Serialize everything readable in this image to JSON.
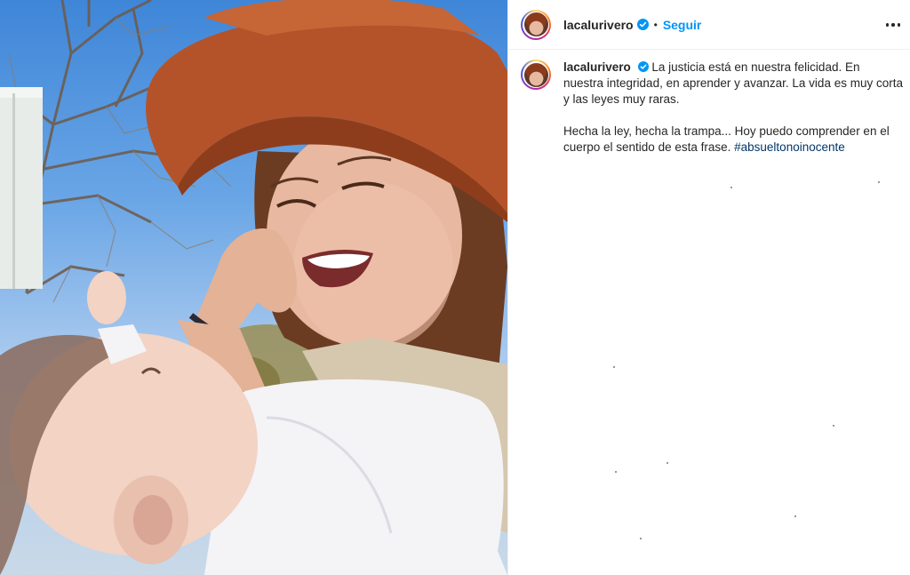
{
  "post": {
    "username": "lacalurivero",
    "separator": "•",
    "follow_label": "Seguir",
    "caption_first": "La justicia está en nuestra felicidad. En nuestra integridad, en aprender y avanzar. La vida es muy corta y las leyes muy raras.",
    "caption_second": "Hecha la ley, hecha la trampa... Hoy puedo comprender en el cuerpo el sentido de esta frase.",
    "hashtag": "#absueltonoinocente"
  },
  "icons": {
    "verified": "verified-badge-icon",
    "more": "more-options-icon"
  },
  "colors": {
    "follow": "#0095f6",
    "hashtag": "#00376b",
    "verified": "#0095f6",
    "hat": "#b4532a",
    "sky": "#4f93de"
  }
}
